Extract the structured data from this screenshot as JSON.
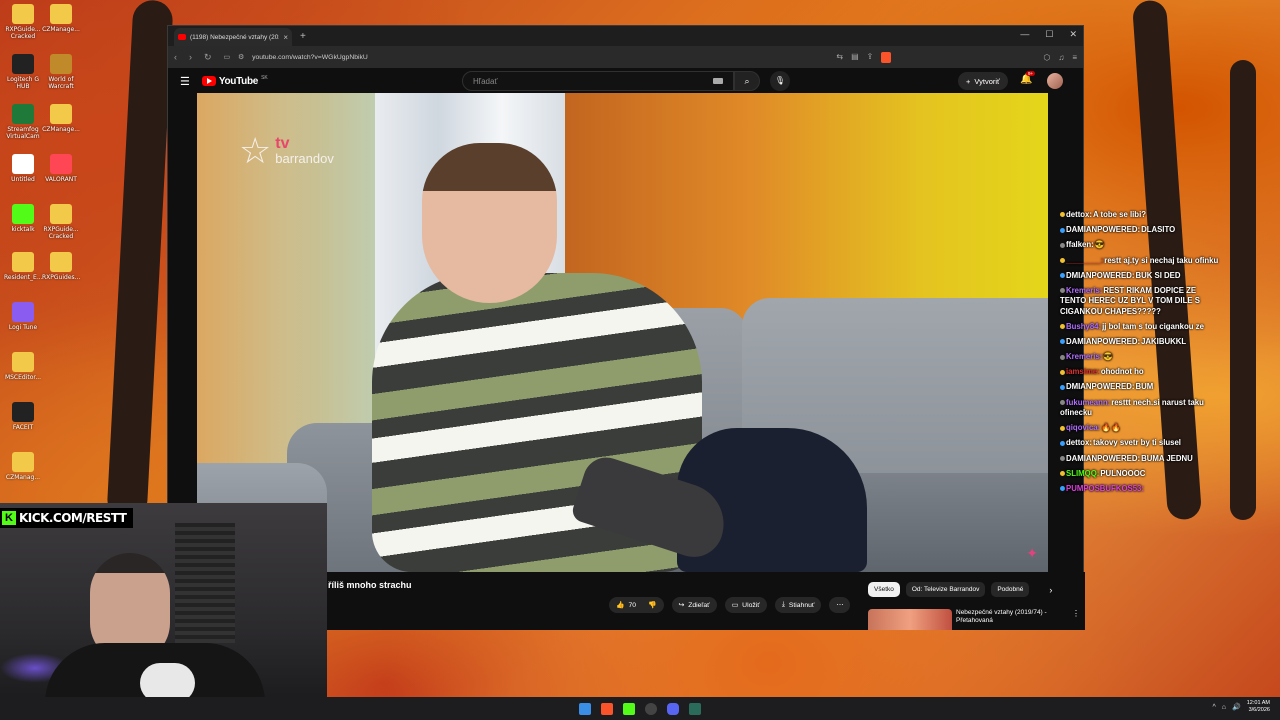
{
  "browser": {
    "tab_title": "(1198) Nebezpečné vztahy (2020",
    "url": "youtube.com/watch?v=WGkUgpNbikU"
  },
  "youtube": {
    "logo_text": "YouTube",
    "country": "SK",
    "search_placeholder": "Hľadať",
    "create_label": "Vytvoriť",
    "notif_badge": "9+",
    "video_title": "říliš mnoho strachu",
    "likes": "70",
    "share_label": "Zdieľať",
    "save_label": "Uložiť",
    "download_label": "Stiahnuť",
    "chips": [
      "Všetko",
      "Od: Televize Barrandov",
      "Podobné"
    ],
    "rec_title": "Nebezpečné vztahy (2019/74) - Přetahovaná"
  },
  "video": {
    "channel_logo_tv": "tv",
    "channel_logo_name": "barrandov"
  },
  "chat": [
    {
      "user": "dettox:",
      "text": "A tobe se libi?",
      "ucolor": "#ffffff"
    },
    {
      "user": "DAMIANPOWERED:",
      "text": "DLASITO",
      "ucolor": "#ffffff"
    },
    {
      "user": "ffalken:",
      "text": "😎",
      "ucolor": "#ffffff"
    },
    {
      "user": "________:",
      "text": "restt aj.ty si nechaj taku ofinku",
      "ucolor": "#e03030"
    },
    {
      "user": "DMIANPOWERED:",
      "text": "BUK SI DED",
      "ucolor": "#ffffff"
    },
    {
      "user": "Kremeris:",
      "text": "REST RIKAM DOPICE ZE TENTO HEREC UZ BYL V TOM DILE S CIGANKOU CHAPES?????",
      "ucolor": "#b070ff"
    },
    {
      "user": "Bushy84:",
      "text": "jj bol tam s tou cigankou ze",
      "ucolor": "#b070ff"
    },
    {
      "user": "DAMIANPOWERED:",
      "text": "JAKIBUKKL",
      "ucolor": "#ffffff"
    },
    {
      "user": "Kremeris:",
      "text": "😎",
      "ucolor": "#b070ff"
    },
    {
      "user": "iamsime:",
      "text": "ohodnot ho",
      "ucolor": "#e03030"
    },
    {
      "user": "DMIANPOWERED:",
      "text": "BUM",
      "ucolor": "#ffffff"
    },
    {
      "user": "fukumeann:",
      "text": "resttt nech.si narust taku ofinecku",
      "ucolor": "#b070ff"
    },
    {
      "user": "qiqovica:",
      "text": "🔥🔥",
      "ucolor": "#b070ff"
    },
    {
      "user": "dettox:",
      "text": "takovy svetr by ti slusel",
      "ucolor": "#ffffff"
    },
    {
      "user": "DAMIANPOWERED:",
      "text": "BUMA JEDNU",
      "ucolor": "#ffffff"
    },
    {
      "user": "SLIMQQ:",
      "text": "PULNOOOC",
      "ucolor": "#53fc18"
    },
    {
      "user": "PUMPOSBUFKOS53:",
      "text": "",
      "ucolor": "#e040e0"
    }
  ],
  "webcam": {
    "label": "KICK.COM/RESTT"
  },
  "desktop_icons": [
    {
      "label": "RXPGuide... Cracked",
      "color": "#f3c94a"
    },
    {
      "label": "CZManage...",
      "color": "#f3c94a"
    },
    {
      "label": "Logitech G HUB",
      "color": "#222222"
    },
    {
      "label": "World of Warcraft",
      "color": "#c08a2a"
    },
    {
      "label": "Streamfog VirtualCam",
      "color": "#1f7a3a"
    },
    {
      "label": "CZManage...",
      "color": "#f3c94a"
    },
    {
      "label": "Untitled",
      "color": "#ffffff"
    },
    {
      "label": "VALORANT",
      "color": "#ff4655"
    },
    {
      "label": "kicktalk",
      "color": "#53fc18"
    },
    {
      "label": "RXPGuide... Cracked",
      "color": "#f3c94a"
    },
    {
      "label": "Resident_E...",
      "color": "#f3c94a"
    },
    {
      "label": "RXPGuides...",
      "color": "#f3c94a"
    },
    {
      "label": "Logi Tune",
      "color": "#8a5cf0"
    },
    {
      "label": "MSCEditor...",
      "color": "#f3c94a"
    },
    {
      "label": "FACEIT",
      "color": "#222222"
    },
    {
      "label": "CZManag...",
      "color": "#f3c94a"
    }
  ],
  "taskbar": {
    "time": "12:01 AM",
    "date": "3/6/2026"
  }
}
